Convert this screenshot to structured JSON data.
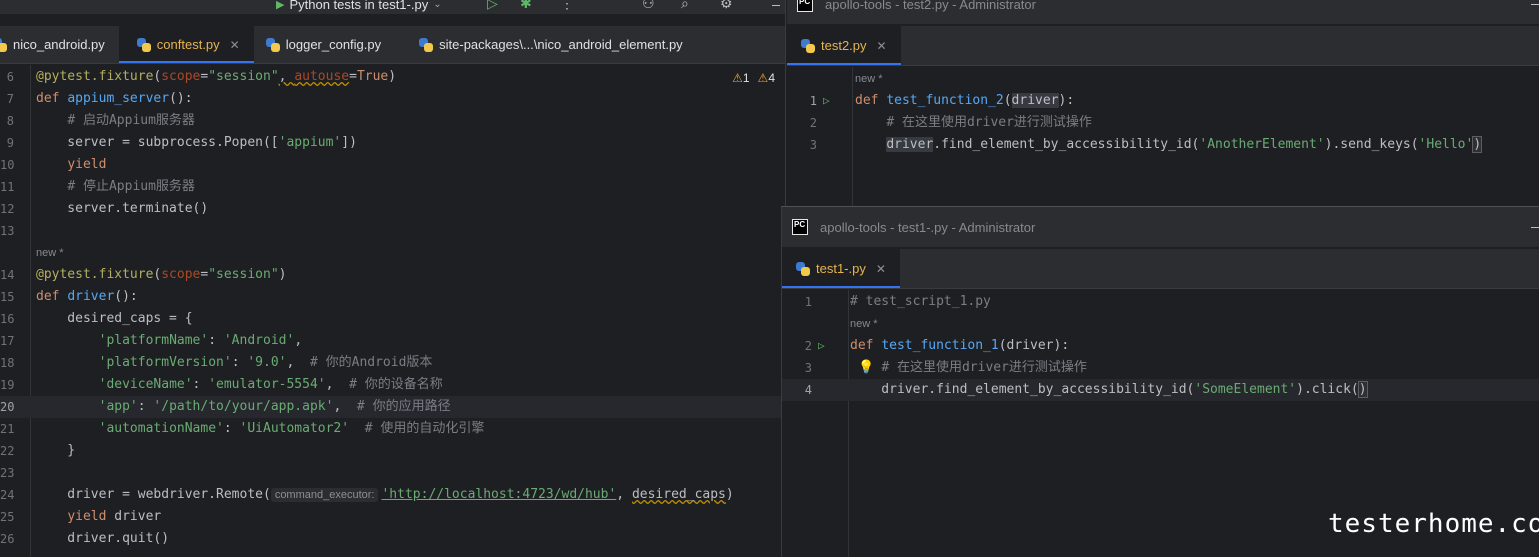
{
  "left_window": {
    "run_config": "Python tests in test1-.py",
    "tabs": [
      {
        "label": "nico_android.py"
      },
      {
        "label": "conftest.py",
        "active": true
      },
      {
        "label": "logger_config.py"
      },
      {
        "label": "site-packages\\...\\nico_android_element.py"
      }
    ],
    "warnings": {
      "weak": "1",
      "strong": "4"
    },
    "inlay_label": "command_executor:",
    "new_marker": "new *"
  },
  "test2_window": {
    "title": "apollo-tools - test2.py - Administrator",
    "tab": "test2.py",
    "new_marker": "new *"
  },
  "test1_window": {
    "title": "apollo-tools - test1-.py - Administrator",
    "tab": "test1-.py",
    "new_marker": "new *"
  },
  "watermark": "testerhome.com",
  "colors": {
    "bg": "#1e1f22",
    "panel": "#2b2d30",
    "keyword": "#cf8e6d",
    "function": "#56a8f5",
    "string": "#6aab73",
    "comment": "#7a7e85",
    "decorator": "#b3ae60",
    "accent": "#3574f0"
  }
}
